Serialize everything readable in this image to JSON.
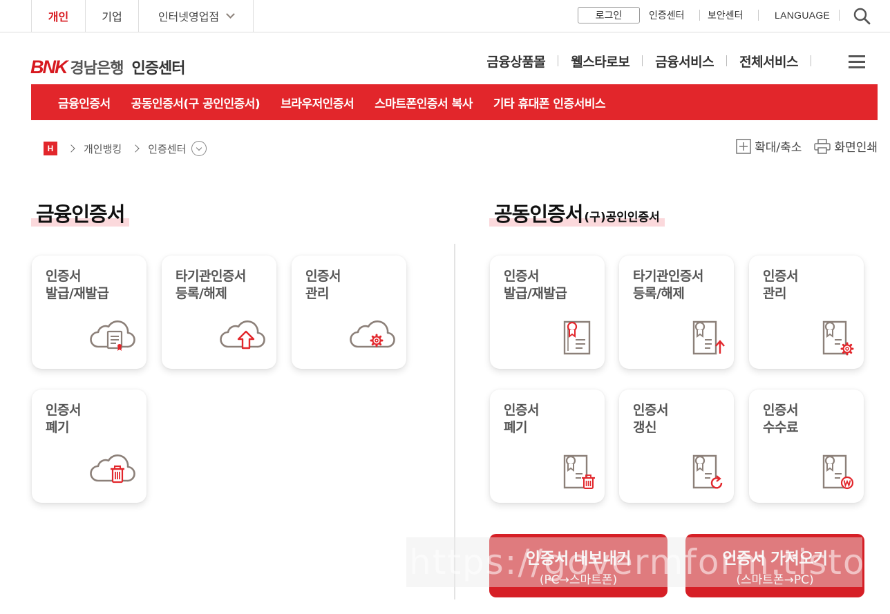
{
  "topbar": {
    "tabs": [
      "개인",
      "기업",
      "인터넷영업점"
    ],
    "login": "로그인",
    "links": [
      "인증센터",
      "보안센터",
      "LANGUAGE"
    ]
  },
  "header": {
    "logo_brand": "BNK",
    "logo_bank": "경남은행",
    "logo_section": "인증센터",
    "gnb": [
      "금융상품몰",
      "웰스타로보",
      "금융서비스",
      "전체서비스"
    ]
  },
  "rednav": [
    "금융인증서",
    "공동인증서(구 공인인증서)",
    "브라우저인증서",
    "스마트폰인증서 복사",
    "기타 휴대폰 인증서비스"
  ],
  "breadcrumb": {
    "home": "H",
    "items": [
      "개인뱅킹",
      "인증센터"
    ]
  },
  "tools": {
    "zoom": "확대/축소",
    "print": "화면인쇄"
  },
  "financial": {
    "title": "금융인증서",
    "cards": [
      {
        "l1": "인증서",
        "l2": "발급/재발급",
        "icon": "cloud-document-icon"
      },
      {
        "l1": "타기관인증서",
        "l2": "등록/해제",
        "icon": "cloud-upload-icon"
      },
      {
        "l1": "인증서",
        "l2": "관리",
        "icon": "cloud-gear-icon"
      },
      {
        "l1": "인증서",
        "l2": "폐기",
        "icon": "cloud-trash-icon"
      }
    ]
  },
  "joint": {
    "title": "공동인증서",
    "subtitle": "(구)공인인증서",
    "cards": [
      {
        "l1": "인증서",
        "l2": "발급/재발급",
        "icon": "certificate-icon"
      },
      {
        "l1": "타기관인증서",
        "l2": "등록/해제",
        "icon": "certificate-upload-icon"
      },
      {
        "l1": "인증서",
        "l2": "관리",
        "icon": "certificate-gear-icon"
      },
      {
        "l1": "인증서",
        "l2": "폐기",
        "icon": "certificate-trash-icon"
      },
      {
        "l1": "인증서",
        "l2": "갱신",
        "icon": "certificate-refresh-icon"
      },
      {
        "l1": "인증서",
        "l2": "수수료",
        "icon": "certificate-fee-icon"
      }
    ]
  },
  "buttons": {
    "export_l1": "인증서 내보내기",
    "export_l2": "(PC→스마트폰)",
    "import_l1": "인증서 가져오기",
    "import_l2": "(스마트폰→PC)"
  },
  "watermark": "https://govermform.tistory.com",
  "colors": {
    "brand_red": "#e2262b",
    "button_red": "#d61f26",
    "highlight_pink": "#fbd9dc"
  }
}
